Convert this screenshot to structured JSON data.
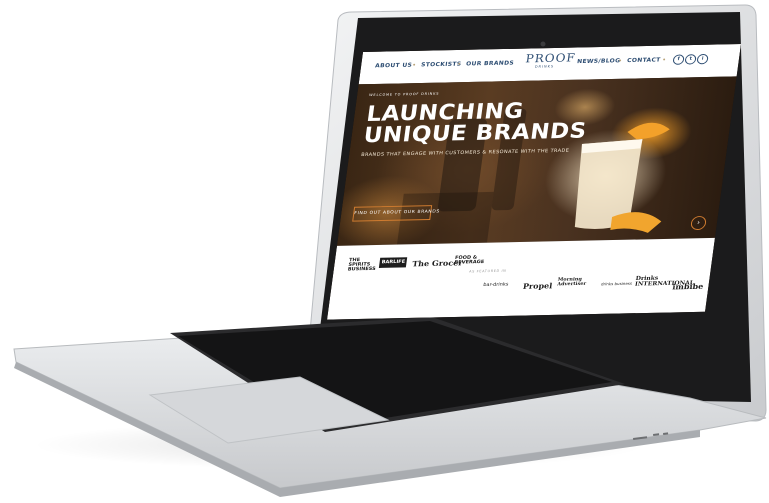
{
  "nav": {
    "links": [
      "ABOUT US",
      "STOCKISTS",
      "OUR BRANDS",
      "NEWS/BLOG",
      "CONTACT"
    ],
    "logo": "PROOF",
    "logo_sub": "DRINKS",
    "social": [
      "f",
      "t",
      "i"
    ]
  },
  "hero": {
    "kicker": "WELCOME TO PROOF DRINKS",
    "title": "LAUNCHING UNIQUE BRANDS",
    "subtitle": "BRANDS THAT ENGAGE WITH CUSTOMERS & RESONATE WITH THE TRADE",
    "button": "FIND OUT ABOUT OUR BRANDS",
    "arrow": "›"
  },
  "press": {
    "label": "AS FEATURED IN",
    "logos": [
      "THE SPIRITS BUSINESS",
      "BARLIFE",
      "The Grocer",
      "FOOD & BEVERAGE",
      "bar-drinks",
      "Propel",
      "Morning Advertiser",
      "drinks business",
      "Drinks INTERNATIONAL",
      "imbibe"
    ]
  },
  "colors": {
    "nav_text": "#2e4e73",
    "accent": "#d07c30",
    "laptop_body": "#d8dadc"
  }
}
